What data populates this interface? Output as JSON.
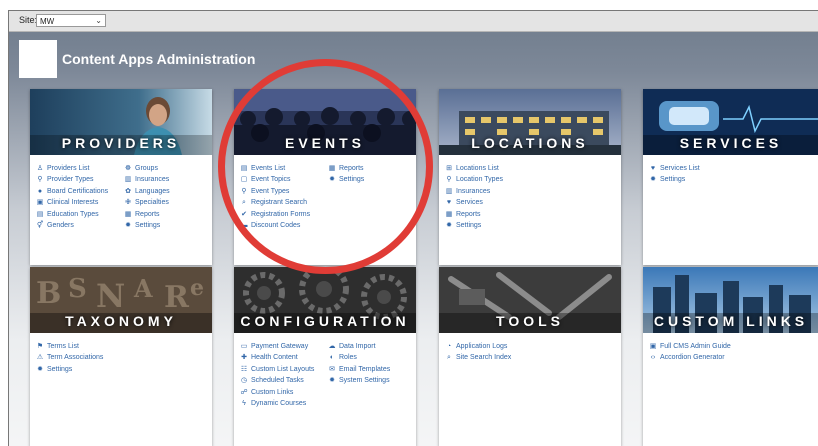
{
  "top": {
    "site_label": "Site:",
    "site_value": "MW"
  },
  "header": {
    "title": "Content Apps Administration"
  },
  "cards": [
    {
      "title": "PROVIDERS",
      "columns": 2,
      "links": [
        {
          "icon": "user-icon",
          "glyph": "♙",
          "label": "Providers List"
        },
        {
          "icon": "groups-icon",
          "glyph": "☸",
          "label": "Groups"
        },
        {
          "icon": "type-icon",
          "glyph": "⚲",
          "label": "Provider Types"
        },
        {
          "icon": "insurances-icon",
          "glyph": "▥",
          "label": "Insurances"
        },
        {
          "icon": "certification-icon",
          "glyph": "●",
          "label": "Board Certifications"
        },
        {
          "icon": "languages-icon",
          "glyph": "✿",
          "label": "Languages"
        },
        {
          "icon": "clinical-icon",
          "glyph": "▣",
          "label": "Clinical Interests"
        },
        {
          "icon": "specialties-icon",
          "glyph": "✙",
          "label": "Specialties"
        },
        {
          "icon": "education-icon",
          "glyph": "▤",
          "label": "Education Types"
        },
        {
          "icon": "reports-icon",
          "glyph": "▦",
          "label": "Reports"
        },
        {
          "icon": "genders-icon",
          "glyph": "⚥",
          "label": "Genders"
        },
        {
          "icon": "settings-icon",
          "glyph": "✹",
          "label": "Settings"
        }
      ]
    },
    {
      "title": "EVENTS",
      "columns": 2,
      "links": [
        {
          "icon": "events-list-icon",
          "glyph": "▤",
          "label": "Events List"
        },
        {
          "icon": "reports-icon",
          "glyph": "▦",
          "label": "Reports"
        },
        {
          "icon": "event-topics-icon",
          "glyph": "▢",
          "label": "Event Topics"
        },
        {
          "icon": "settings-icon",
          "glyph": "✹",
          "label": "Settings"
        },
        {
          "icon": "event-types-icon",
          "glyph": "⚲",
          "label": "Event Types"
        },
        {
          "icon": "search-icon",
          "glyph": "⌕",
          "label": "Registrant Search"
        },
        {
          "icon": "forms-icon",
          "glyph": "✔",
          "label": "Registration Forms"
        },
        {
          "icon": "discount-icon",
          "glyph": "▬",
          "label": "Discount Codes"
        }
      ]
    },
    {
      "title": "LOCATIONS",
      "columns": 1,
      "links": [
        {
          "icon": "locations-list-icon",
          "glyph": "⊞",
          "label": "Locations List"
        },
        {
          "icon": "location-types-icon",
          "glyph": "⚲",
          "label": "Location Types"
        },
        {
          "icon": "insurances-icon",
          "glyph": "▥",
          "label": "Insurances"
        },
        {
          "icon": "services-icon",
          "glyph": "♥",
          "label": "Services"
        },
        {
          "icon": "reports-icon",
          "glyph": "▦",
          "label": "Reports"
        },
        {
          "icon": "settings-icon",
          "glyph": "✹",
          "label": "Settings"
        }
      ]
    },
    {
      "title": "SERVICES",
      "columns": 1,
      "links": [
        {
          "icon": "services-list-icon",
          "glyph": "♥",
          "label": "Services List"
        },
        {
          "icon": "settings-icon",
          "glyph": "✹",
          "label": "Settings"
        }
      ]
    },
    {
      "title": "TAXONOMY",
      "columns": 1,
      "links": [
        {
          "icon": "terms-icon",
          "glyph": "⚑",
          "label": "Terms List"
        },
        {
          "icon": "associations-icon",
          "glyph": "⚠",
          "label": "Term Associations"
        },
        {
          "icon": "settings-icon",
          "glyph": "✹",
          "label": "Settings"
        }
      ]
    },
    {
      "title": "CONFIGURATION",
      "columns": 2,
      "links": [
        {
          "icon": "payment-icon",
          "glyph": "▭",
          "label": "Payment Gateway"
        },
        {
          "icon": "data-import-icon",
          "glyph": "☁",
          "label": "Data Import"
        },
        {
          "icon": "health-icon",
          "glyph": "✚",
          "label": "Health Content"
        },
        {
          "icon": "roles-icon",
          "glyph": "◐",
          "label": "Roles"
        },
        {
          "icon": "list-layouts-icon",
          "glyph": "☷",
          "label": "Custom List Layouts"
        },
        {
          "icon": "email-icon",
          "glyph": "✉",
          "label": "Email Templates"
        },
        {
          "icon": "scheduled-icon",
          "glyph": "◷",
          "label": "Scheduled Tasks"
        },
        {
          "icon": "settings-icon",
          "glyph": "✹",
          "label": "System Settings"
        },
        {
          "icon": "custom-links-icon",
          "glyph": "☍",
          "label": "Custom Links"
        },
        {
          "icon": "courses-icon",
          "glyph": "ϟ",
          "label": "Dynamic Courses"
        }
      ]
    },
    {
      "title": "TOOLS",
      "columns": 1,
      "links": [
        {
          "icon": "logs-icon",
          "glyph": "◔",
          "label": "Application Logs"
        },
        {
          "icon": "search-icon",
          "glyph": "⌕",
          "label": "Site Search Index"
        }
      ]
    },
    {
      "title": "CUSTOM LINKS",
      "columns": 1,
      "links": [
        {
          "icon": "guide-icon",
          "glyph": "▣",
          "label": "Full CMS Admin Guide"
        },
        {
          "icon": "code-icon",
          "glyph": "‹›",
          "label": "Accordion Generator"
        }
      ]
    }
  ],
  "colors": {
    "link": "#3267a8",
    "highlight_circle": "#e03c36",
    "title_text": "#ffffff"
  }
}
